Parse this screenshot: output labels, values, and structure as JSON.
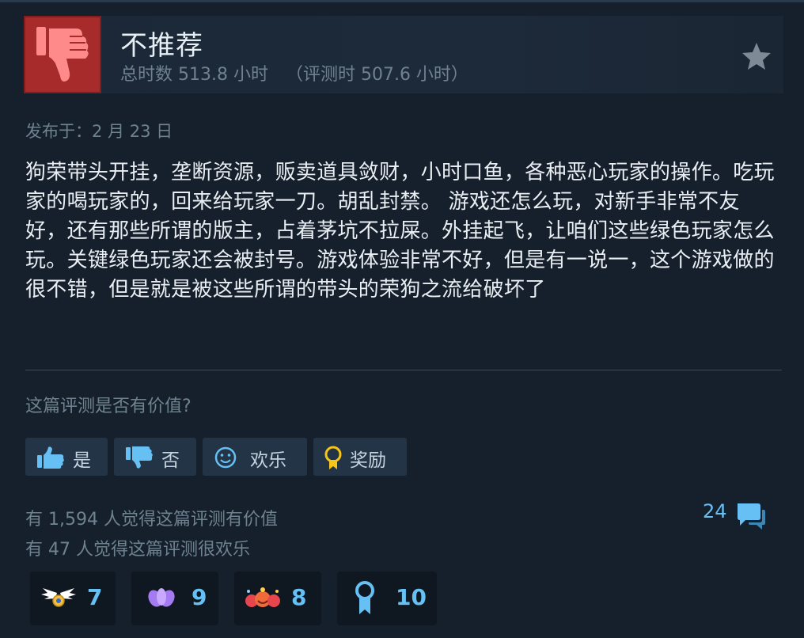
{
  "review": {
    "title": "不推荐",
    "hours_total": "总时数 513.8 小时",
    "hours_at_review": "（评测时 507.6 小时）",
    "posted": "发布于：2 月 23 日",
    "body": "狗荣带头开挂，垄断资源，贩卖道具敛财，小时口鱼，各种恶心玩家的操作。吃玩家的喝玩家的，回来给玩家一刀。胡乱封禁。 游戏还怎么玩，对新手非常不友好，还有那些所谓的版主，占着茅坑不拉屎。外挂起飞，让咱们这些绿色玩家怎么玩。关键绿色玩家还会被封号。游戏体验非常不好，但是有一说一，这个游戏做的很不错，但是就是被这些所谓的带头的荣狗之流给破坏了"
  },
  "vote": {
    "question": "这篇评测是否有价值?",
    "yes": "是",
    "no": "否",
    "funny": "欢乐",
    "award": "奖励"
  },
  "stats": {
    "helpful": "有 1,594 人觉得这篇评测有价值",
    "funny": "有 47 人觉得这篇评测很欢乐",
    "comments": "24"
  },
  "awards": [
    {
      "icon": "winged-medal-icon",
      "count": "7"
    },
    {
      "icon": "purple-lotus-icon",
      "count": "9"
    },
    {
      "icon": "party-blob-icon",
      "count": "8"
    },
    {
      "icon": "ribbon-medal-icon",
      "count": "10"
    }
  ],
  "colors": {
    "background": "#16202d",
    "thumb_down_box": "#a72b2b",
    "link_blue": "#66c0f4",
    "muted_text": "#6f8290",
    "button_bg": "#243447"
  }
}
